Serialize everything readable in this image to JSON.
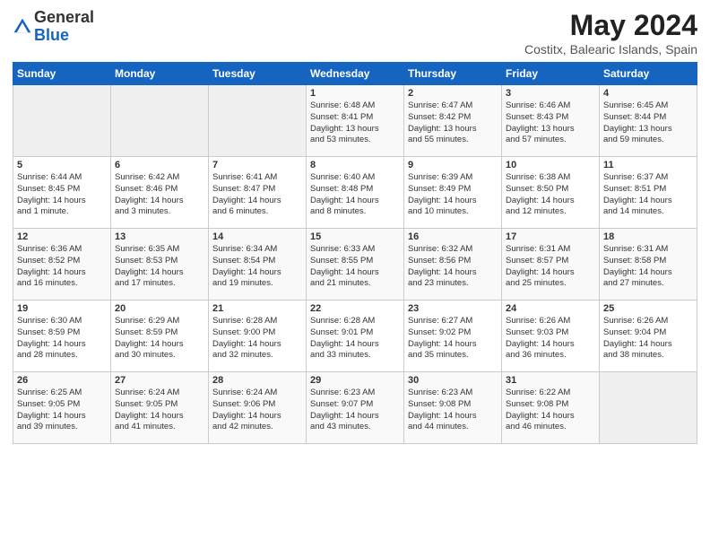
{
  "header": {
    "logo_general": "General",
    "logo_blue": "Blue",
    "title": "May 2024",
    "subtitle": "Costitx, Balearic Islands, Spain"
  },
  "days_of_week": [
    "Sunday",
    "Monday",
    "Tuesday",
    "Wednesday",
    "Thursday",
    "Friday",
    "Saturday"
  ],
  "weeks": [
    [
      {
        "day": "",
        "info": ""
      },
      {
        "day": "",
        "info": ""
      },
      {
        "day": "",
        "info": ""
      },
      {
        "day": "1",
        "info": "Sunrise: 6:48 AM\nSunset: 8:41 PM\nDaylight: 13 hours\nand 53 minutes."
      },
      {
        "day": "2",
        "info": "Sunrise: 6:47 AM\nSunset: 8:42 PM\nDaylight: 13 hours\nand 55 minutes."
      },
      {
        "day": "3",
        "info": "Sunrise: 6:46 AM\nSunset: 8:43 PM\nDaylight: 13 hours\nand 57 minutes."
      },
      {
        "day": "4",
        "info": "Sunrise: 6:45 AM\nSunset: 8:44 PM\nDaylight: 13 hours\nand 59 minutes."
      }
    ],
    [
      {
        "day": "5",
        "info": "Sunrise: 6:44 AM\nSunset: 8:45 PM\nDaylight: 14 hours\nand 1 minute."
      },
      {
        "day": "6",
        "info": "Sunrise: 6:42 AM\nSunset: 8:46 PM\nDaylight: 14 hours\nand 3 minutes."
      },
      {
        "day": "7",
        "info": "Sunrise: 6:41 AM\nSunset: 8:47 PM\nDaylight: 14 hours\nand 6 minutes."
      },
      {
        "day": "8",
        "info": "Sunrise: 6:40 AM\nSunset: 8:48 PM\nDaylight: 14 hours\nand 8 minutes."
      },
      {
        "day": "9",
        "info": "Sunrise: 6:39 AM\nSunset: 8:49 PM\nDaylight: 14 hours\nand 10 minutes."
      },
      {
        "day": "10",
        "info": "Sunrise: 6:38 AM\nSunset: 8:50 PM\nDaylight: 14 hours\nand 12 minutes."
      },
      {
        "day": "11",
        "info": "Sunrise: 6:37 AM\nSunset: 8:51 PM\nDaylight: 14 hours\nand 14 minutes."
      }
    ],
    [
      {
        "day": "12",
        "info": "Sunrise: 6:36 AM\nSunset: 8:52 PM\nDaylight: 14 hours\nand 16 minutes."
      },
      {
        "day": "13",
        "info": "Sunrise: 6:35 AM\nSunset: 8:53 PM\nDaylight: 14 hours\nand 17 minutes."
      },
      {
        "day": "14",
        "info": "Sunrise: 6:34 AM\nSunset: 8:54 PM\nDaylight: 14 hours\nand 19 minutes."
      },
      {
        "day": "15",
        "info": "Sunrise: 6:33 AM\nSunset: 8:55 PM\nDaylight: 14 hours\nand 21 minutes."
      },
      {
        "day": "16",
        "info": "Sunrise: 6:32 AM\nSunset: 8:56 PM\nDaylight: 14 hours\nand 23 minutes."
      },
      {
        "day": "17",
        "info": "Sunrise: 6:31 AM\nSunset: 8:57 PM\nDaylight: 14 hours\nand 25 minutes."
      },
      {
        "day": "18",
        "info": "Sunrise: 6:31 AM\nSunset: 8:58 PM\nDaylight: 14 hours\nand 27 minutes."
      }
    ],
    [
      {
        "day": "19",
        "info": "Sunrise: 6:30 AM\nSunset: 8:59 PM\nDaylight: 14 hours\nand 28 minutes."
      },
      {
        "day": "20",
        "info": "Sunrise: 6:29 AM\nSunset: 8:59 PM\nDaylight: 14 hours\nand 30 minutes."
      },
      {
        "day": "21",
        "info": "Sunrise: 6:28 AM\nSunset: 9:00 PM\nDaylight: 14 hours\nand 32 minutes."
      },
      {
        "day": "22",
        "info": "Sunrise: 6:28 AM\nSunset: 9:01 PM\nDaylight: 14 hours\nand 33 minutes."
      },
      {
        "day": "23",
        "info": "Sunrise: 6:27 AM\nSunset: 9:02 PM\nDaylight: 14 hours\nand 35 minutes."
      },
      {
        "day": "24",
        "info": "Sunrise: 6:26 AM\nSunset: 9:03 PM\nDaylight: 14 hours\nand 36 minutes."
      },
      {
        "day": "25",
        "info": "Sunrise: 6:26 AM\nSunset: 9:04 PM\nDaylight: 14 hours\nand 38 minutes."
      }
    ],
    [
      {
        "day": "26",
        "info": "Sunrise: 6:25 AM\nSunset: 9:05 PM\nDaylight: 14 hours\nand 39 minutes."
      },
      {
        "day": "27",
        "info": "Sunrise: 6:24 AM\nSunset: 9:05 PM\nDaylight: 14 hours\nand 41 minutes."
      },
      {
        "day": "28",
        "info": "Sunrise: 6:24 AM\nSunset: 9:06 PM\nDaylight: 14 hours\nand 42 minutes."
      },
      {
        "day": "29",
        "info": "Sunrise: 6:23 AM\nSunset: 9:07 PM\nDaylight: 14 hours\nand 43 minutes."
      },
      {
        "day": "30",
        "info": "Sunrise: 6:23 AM\nSunset: 9:08 PM\nDaylight: 14 hours\nand 44 minutes."
      },
      {
        "day": "31",
        "info": "Sunrise: 6:22 AM\nSunset: 9:08 PM\nDaylight: 14 hours\nand 46 minutes."
      },
      {
        "day": "",
        "info": ""
      }
    ]
  ]
}
